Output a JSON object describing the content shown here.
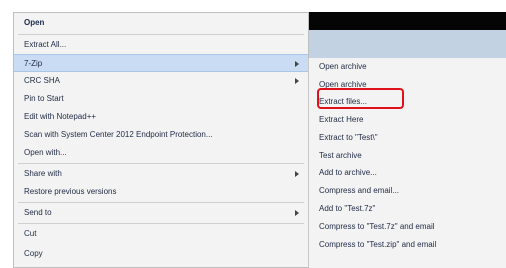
{
  "main_menu": {
    "items": [
      {
        "label": "Open",
        "bold": true,
        "submenu": false
      },
      {
        "label": "Extract All...",
        "bold": false,
        "submenu": false
      },
      {
        "label": "7-Zip",
        "bold": false,
        "submenu": true,
        "highlighted": true
      },
      {
        "label": "CRC SHA",
        "bold": false,
        "submenu": true
      },
      {
        "label": "Pin to Start",
        "bold": false,
        "submenu": false
      },
      {
        "label": "Edit with Notepad++",
        "bold": false,
        "submenu": false
      },
      {
        "label": "Scan with System Center 2012 Endpoint Protection...",
        "bold": false,
        "submenu": false
      },
      {
        "label": "Open with...",
        "bold": false,
        "submenu": false
      },
      {
        "label": "Share with",
        "bold": false,
        "submenu": true
      },
      {
        "label": "Restore previous versions",
        "bold": false,
        "submenu": false
      },
      {
        "label": "Send to",
        "bold": false,
        "submenu": true
      },
      {
        "label": "Cut",
        "bold": false,
        "submenu": false
      },
      {
        "label": "Copy",
        "bold": false,
        "submenu": false
      }
    ]
  },
  "submenu_7zip": {
    "items": [
      {
        "label": "Open archive"
      },
      {
        "label": "Open archive"
      },
      {
        "label": "Extract files..."
      },
      {
        "label": "Extract Here"
      },
      {
        "label": "Extract to \"Test\\\""
      },
      {
        "label": "Test archive"
      },
      {
        "label": "Add to archive..."
      },
      {
        "label": "Compress and email..."
      },
      {
        "label": "Add to \"Test.7z\""
      },
      {
        "label": "Compress to \"Test.7z\" and email"
      },
      {
        "label": "Compress to \"Test.zip\" and email"
      }
    ]
  },
  "highlight_color": "#e0111a"
}
